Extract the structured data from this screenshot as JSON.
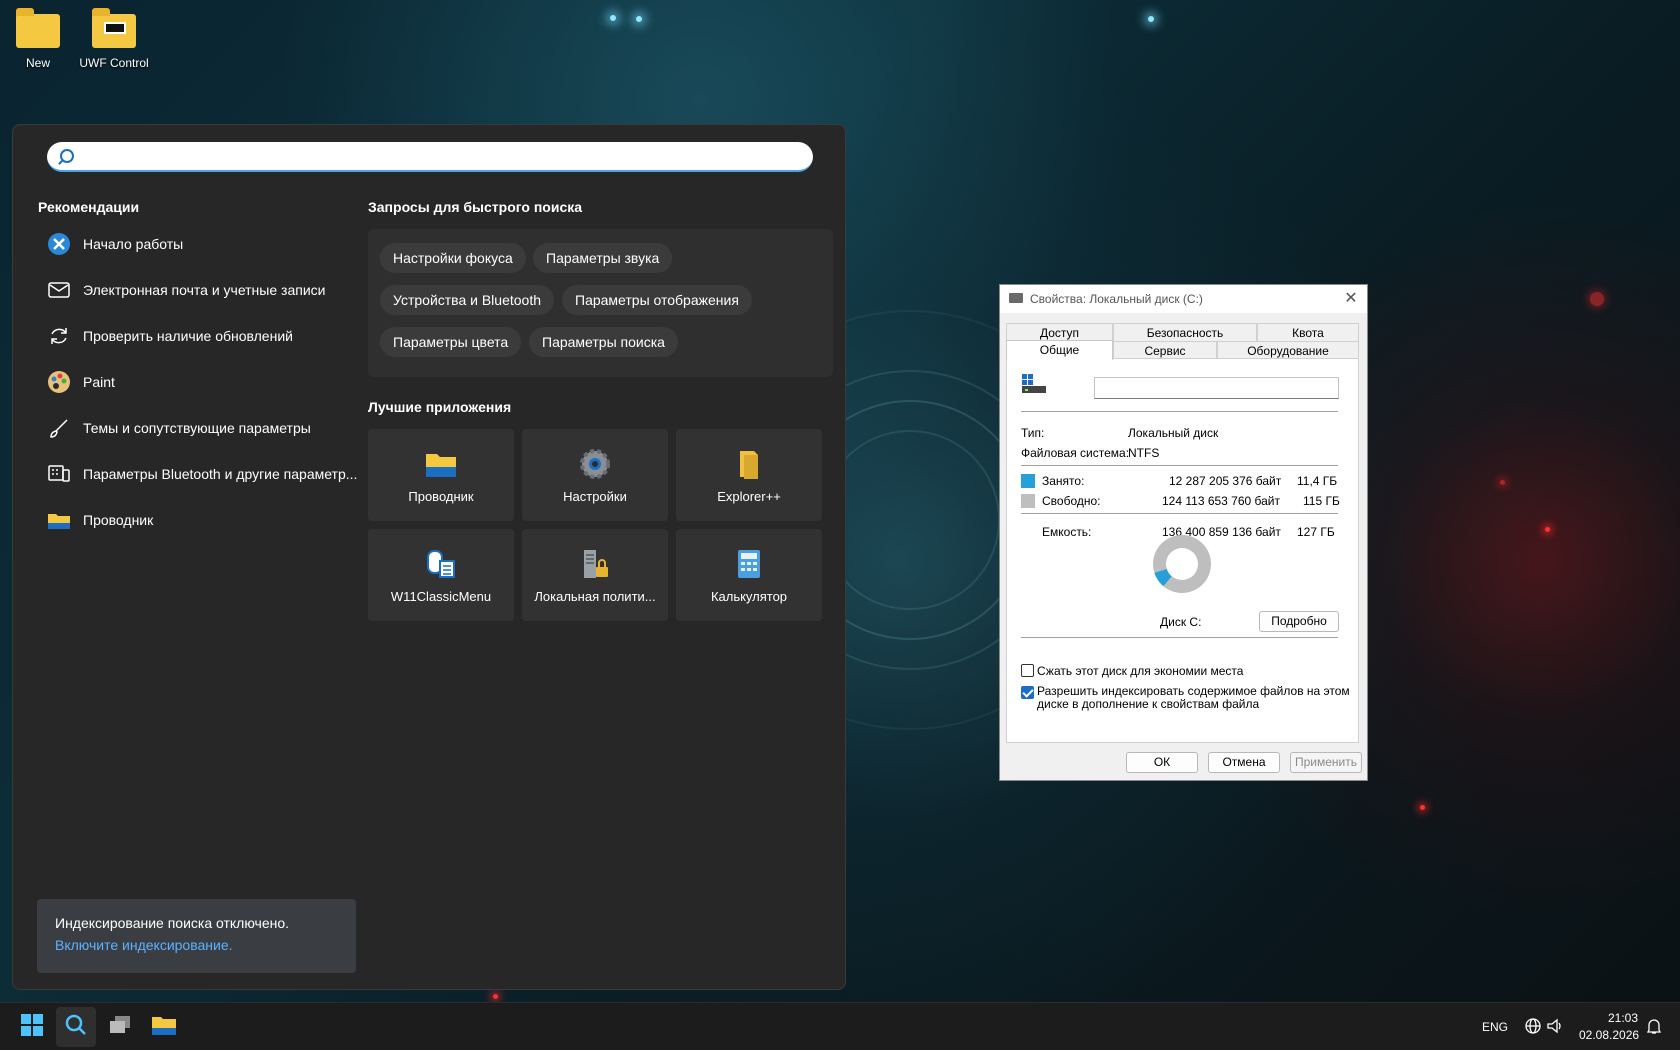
{
  "desktop": {
    "icons": [
      {
        "label": "New"
      },
      {
        "label": "UWF Control"
      }
    ]
  },
  "search": {
    "placeholder": "",
    "recommendations_title": "Рекомендации",
    "recommendations": [
      {
        "label": "Начало работы",
        "icon": "get-started-icon"
      },
      {
        "label": "Электронная почта и учетные записи",
        "icon": "mail-icon"
      },
      {
        "label": "Проверить наличие обновлений",
        "icon": "refresh-icon"
      },
      {
        "label": "Paint",
        "icon": "paint-icon"
      },
      {
        "label": "Темы и сопутствующие параметры",
        "icon": "brush-icon"
      },
      {
        "label": "Параметры Bluetooth и другие параметр...",
        "icon": "bluetooth-devices-icon"
      },
      {
        "label": "Проводник",
        "icon": "folder-icon"
      }
    ],
    "quick_title": "Запросы для быстрого поиска",
    "quick_chips": [
      "Настройки фокуса",
      "Параметры звука",
      "Устройства и Bluetooth",
      "Параметры отображения",
      "Параметры цвета",
      "Параметры поиска"
    ],
    "apps_title": "Лучшие приложения",
    "apps": [
      {
        "label": "Проводник",
        "icon": "folder-icon"
      },
      {
        "label": "Настройки",
        "icon": "gear-icon"
      },
      {
        "label": "Explorer++",
        "icon": "explorerpp-icon"
      },
      {
        "label": "W11ClassicMenu",
        "icon": "classic-menu-icon"
      },
      {
        "label": "Локальная полити...",
        "icon": "security-policy-icon"
      },
      {
        "label": "Калькулятор",
        "icon": "calculator-icon"
      }
    ],
    "notice": {
      "text": "Индексирование поиска отключено.",
      "link": "Включите индексирование."
    }
  },
  "dialog": {
    "title": "Свойства: Локальный диск (C:)",
    "tabs_top": [
      "Доступ",
      "Безопасность",
      "Квота"
    ],
    "tabs_bottom": [
      "Общие",
      "Сервис",
      "Оборудование"
    ],
    "name_value": "",
    "type_label": "Тип:",
    "type_value": "Локальный диск",
    "fs_label": "Файловая система:",
    "fs_value": "NTFS",
    "used_label": "Занято:",
    "used_bytes": "12 287 205 376 байт",
    "used_gb": "11,4 ГБ",
    "free_label": "Свободно:",
    "free_bytes": "124 113 653 760 байт",
    "free_gb": "115 ГБ",
    "capacity_label": "Емкость:",
    "capacity_bytes": "136 400 859 136 байт",
    "capacity_gb": "127 ГБ",
    "used_fraction": 0.09,
    "used_color": "#26a0da",
    "free_color": "#bebebe",
    "disk_label": "Диск C:",
    "details_button": "Подробно",
    "compress_label": "Сжать этот диск для экономии места",
    "compress_checked": false,
    "index_label_1": "Разрешить индексировать содержимое файлов на этом",
    "index_label_2": "диске в дополнение к свойствам файла",
    "index_checked": true,
    "ok": "ОК",
    "cancel": "Отмена",
    "apply": "Применить"
  },
  "taskbar": {
    "lang": "ENG",
    "time": "21:03",
    "date": "02.08.2026"
  }
}
